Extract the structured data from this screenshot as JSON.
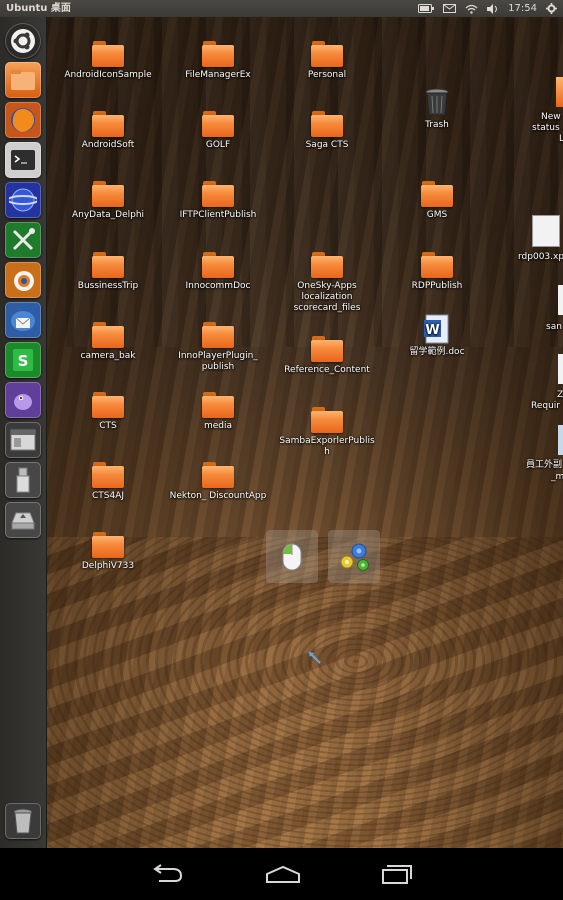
{
  "topbar": {
    "title": "Ubuntu 桌面",
    "time": "17:54",
    "tray_icons": [
      "battery-icon",
      "mail-icon",
      "wifi-icon",
      "volume-icon",
      "gear-icon"
    ]
  },
  "launcher": {
    "items": [
      {
        "name": "ubuntu-logo-icon",
        "color": "#3b3936"
      },
      {
        "name": "files-folder-icon",
        "color": "#e8661c"
      },
      {
        "name": "firefox-icon",
        "color": "#e56a1e"
      },
      {
        "name": "terminal-icon",
        "color": "#3c3c3c"
      },
      {
        "name": "browser-globe-icon",
        "color": "#2c3fa3"
      },
      {
        "name": "tools-icon",
        "color": "#2a8a2a"
      },
      {
        "name": "blender-icon",
        "color": "#d47a1c"
      },
      {
        "name": "thunderbird-icon",
        "color": "#3a6fb8"
      },
      {
        "name": "spreadsheet-icon",
        "color": "#1f9a30"
      },
      {
        "name": "pidgin-icon",
        "color": "#6b4aa8"
      },
      {
        "name": "window-icon",
        "color": "#4a4a4a"
      },
      {
        "name": "usb-drive-icon",
        "color": "#555555"
      },
      {
        "name": "removable-drive-icon",
        "color": "#555555"
      },
      {
        "name": "trash-icon",
        "color": "#555555"
      }
    ]
  },
  "desktop": {
    "folders": [
      {
        "label": "AndroidIconSample"
      },
      {
        "label": "FileManagerEx"
      },
      {
        "label": "Personal"
      },
      {
        "label": "AndroidSoft"
      },
      {
        "label": "GOLF"
      },
      {
        "label": "Saga CTS"
      },
      {
        "label": "AnyData_Delphi"
      },
      {
        "label": "IFTPClientPublish"
      },
      {
        "label": "GMS"
      },
      {
        "label": "BussinessTrip"
      },
      {
        "label": "InnocommDoc"
      },
      {
        "label": "OneSky-Apps localization scorecard_files"
      },
      {
        "label": "RDPPublish"
      },
      {
        "label": "camera_bak"
      },
      {
        "label": "InnoPlayerPlugin_ publish"
      },
      {
        "label": "Reference_Content"
      },
      {
        "label": "CTS"
      },
      {
        "label": "media"
      },
      {
        "label": "SambaExporlerPublish"
      },
      {
        "label": "CTS4AJ"
      },
      {
        "label": "Nekton_ DiscountApp"
      },
      {
        "label": "DelphiV733"
      }
    ],
    "trash_label": "Trash",
    "doc_label": "留学範例.doc",
    "partial_labels": {
      "p1_line1": "New",
      "p1_line2": "status",
      "p2": "rdp003.xp",
      "p3": "san",
      "p4_line1": "Z",
      "p4_line2": "Requir",
      "p5_line1": "員工外副",
      "p5_line2": "_m"
    }
  },
  "mini_toolbar": {
    "items": [
      "mouse-icon",
      "gears-icon"
    ]
  },
  "navbar": {
    "items": [
      "back-icon",
      "home-icon",
      "recents-icon"
    ]
  }
}
